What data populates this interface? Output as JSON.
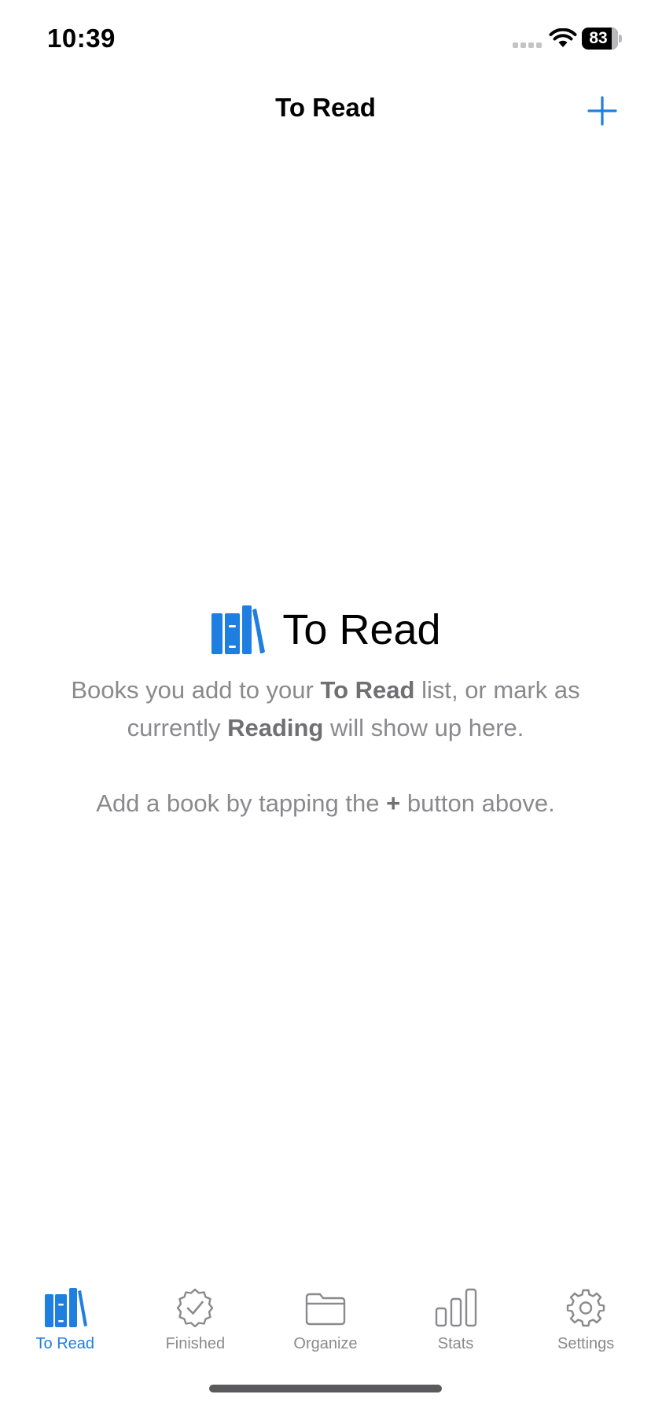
{
  "status_bar": {
    "time": "10:39",
    "battery_level": "83",
    "icons": [
      "signal-icon",
      "wifi-icon",
      "battery-icon"
    ]
  },
  "nav": {
    "title": "To Read",
    "add_icon": "plus-icon"
  },
  "empty_state": {
    "icon": "books-icon",
    "title": "To Read",
    "desc_part1": "Books you add to your ",
    "desc_bold1": "To Read",
    "desc_part2": " list, or mark as currently ",
    "desc_bold2": "Reading",
    "desc_part3": " will show up here.",
    "hint_part1": "Add a book by tapping the ",
    "hint_bold": "+",
    "hint_part2": " button above."
  },
  "tabs": [
    {
      "label": "To Read",
      "icon": "books-icon",
      "active": true
    },
    {
      "label": "Finished",
      "icon": "checkmark-seal-icon",
      "active": false
    },
    {
      "label": "Organize",
      "icon": "folder-icon",
      "active": false
    },
    {
      "label": "Stats",
      "icon": "bar-chart-icon",
      "active": false
    },
    {
      "label": "Settings",
      "icon": "gear-icon",
      "active": false
    }
  ],
  "colors": {
    "accent": "#1e7fe0",
    "secondary_text": "#8a8a8e",
    "background": "#ffffff"
  }
}
